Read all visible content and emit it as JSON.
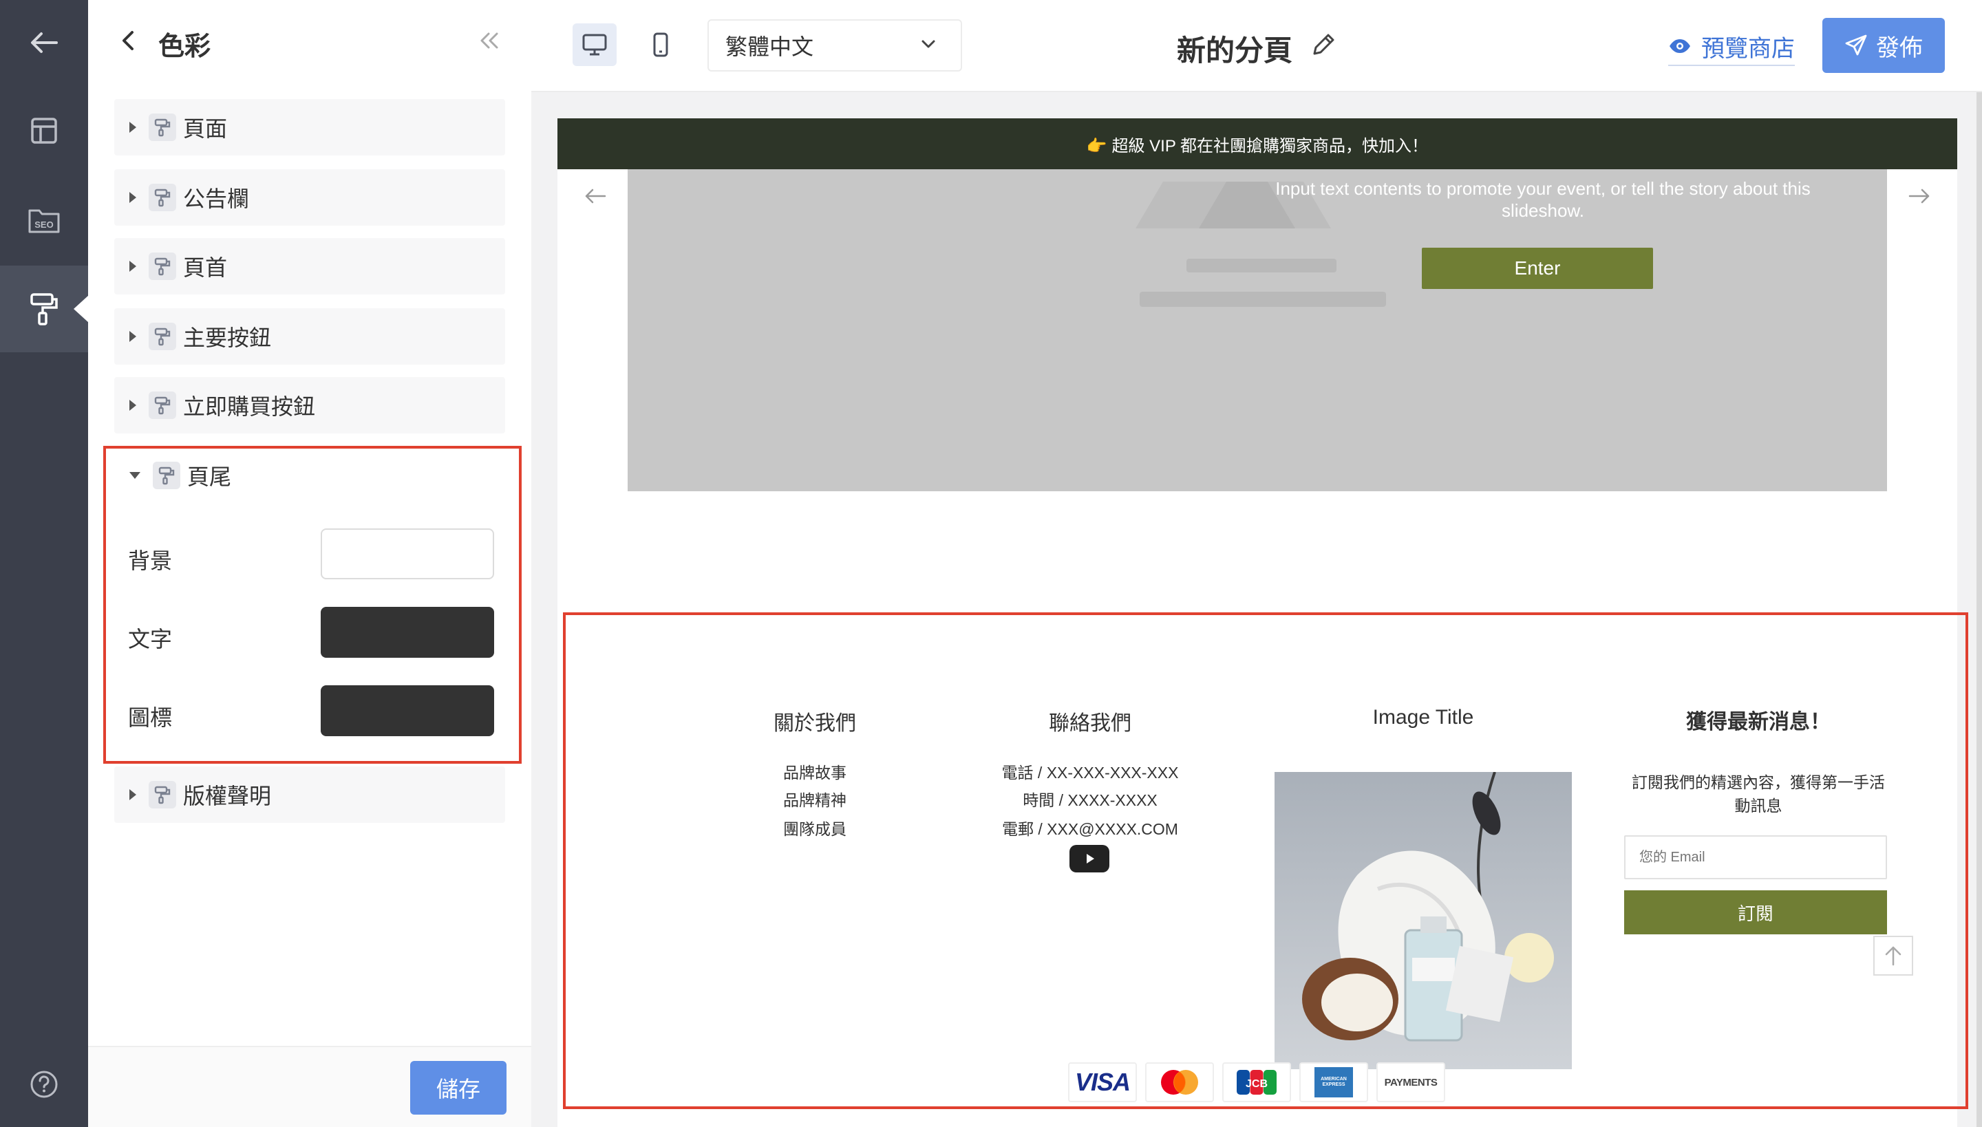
{
  "panel": {
    "title": "色彩",
    "sections": [
      {
        "label": "頁面"
      },
      {
        "label": "公告欄"
      },
      {
        "label": "頁首"
      },
      {
        "label": "主要按鈕"
      },
      {
        "label": "立即購買按鈕"
      },
      {
        "label": "頁尾",
        "expanded": true
      },
      {
        "label": "版權聲明"
      }
    ],
    "footer_colors": [
      {
        "label": "背景",
        "color": "#ffffff"
      },
      {
        "label": "文字",
        "color": "#333333"
      },
      {
        "label": "圖標",
        "color": "#333333"
      }
    ],
    "save_label": "儲存"
  },
  "topbar": {
    "language": "繁體中文",
    "page_name": "新的分頁",
    "preview_label": "預覽商店",
    "publish_label": "發佈"
  },
  "site": {
    "announcement": "👉 超級 VIP 都在社團搶購獨家商品，快加入！",
    "slide": {
      "text": "Input text contents to promote your event, or tell the story about this slideshow.",
      "button": "Enter"
    },
    "footer": {
      "about": {
        "title": "關於我們",
        "links": [
          "品牌故事",
          "品牌精神",
          "團隊成員"
        ]
      },
      "contact": {
        "title": "聯絡我們",
        "lines": [
          "電話 / XX-XXX-XXX-XXX",
          "時間 / XXXX-XXXX",
          "電郵 / XXX@XXXX.COM"
        ]
      },
      "image_title": "Image Title",
      "newsletter": {
        "title": "獲得最新消息！",
        "desc": "訂閱我們的精選內容，獲得第一手活動訊息",
        "placeholder": "您的 Email",
        "button": "訂閱"
      },
      "payments": [
        "VISA",
        "Mastercard",
        "JCB",
        "AMERICAN EXPRESS",
        "PAYMENTS"
      ]
    }
  },
  "colors": {
    "accent": "#5f8fe6",
    "rail": "#3b3f4b",
    "announce_bg": "#2d3528",
    "olive": "#707e34",
    "highlight": "#e0402f"
  }
}
